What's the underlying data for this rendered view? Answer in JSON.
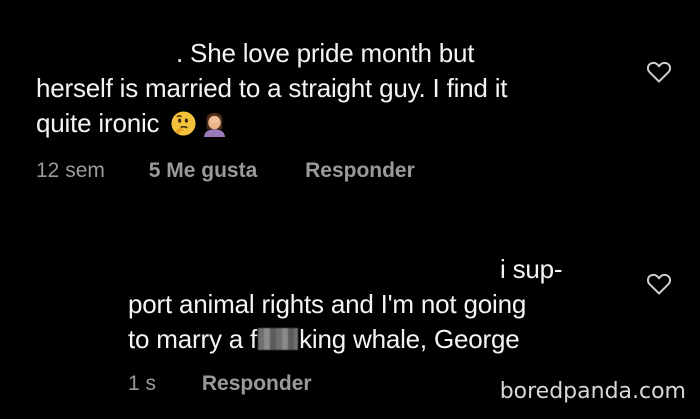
{
  "comment_1": {
    "lines": [
      ". She love pride month but",
      "herself is married to a straight guy. I find it",
      "quite ironic"
    ],
    "emojis": [
      "thinking-face-emoji",
      "facepalm-emoji"
    ],
    "time": "12 sem",
    "likes": "5 Me gusta",
    "reply_label": "Responder"
  },
  "comment_2": {
    "lines": [
      "i sup-",
      "port animal rights and I'm not going",
      "to marry a f",
      "king whale, George"
    ],
    "time": "1 s",
    "reply_label": "Responder"
  },
  "watermark": "boredpanda.com",
  "colors": {
    "background": "#000000",
    "text": "#f4f4f4",
    "meta": "#9a9a9a"
  }
}
